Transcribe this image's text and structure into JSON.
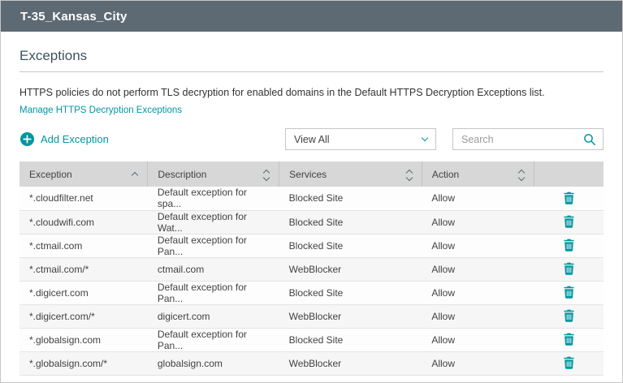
{
  "titlebar": {
    "title": "T-35_Kansas_City"
  },
  "section": {
    "title": "Exceptions"
  },
  "intro": {
    "description": "HTTPS policies do not perform TLS decryption for enabled domains in the Default HTTPS Decryption Exceptions list.",
    "manage_link": "Manage HTTPS Decryption Exceptions"
  },
  "toolbar": {
    "add_label": "Add Exception",
    "filter_value": "View All",
    "search_placeholder": "Search"
  },
  "colors": {
    "accent_teal": "#0097a0",
    "titlebar_bg": "#5d6a74",
    "table_header_bg": "#d7d7d7"
  },
  "table": {
    "columns": [
      "Exception",
      "Description",
      "Services",
      "Action"
    ],
    "sorted_column": "Exception",
    "sort_direction": "asc",
    "rows": [
      {
        "exception": "*.cloudfilter.net",
        "description": "Default exception for spa...",
        "services": "Blocked Site",
        "action": "Allow"
      },
      {
        "exception": "*.cloudwifi.com",
        "description": "Default exception for Wat...",
        "services": "Blocked Site",
        "action": "Allow"
      },
      {
        "exception": "*.ctmail.com",
        "description": "Default exception for Pan...",
        "services": "Blocked Site",
        "action": "Allow"
      },
      {
        "exception": "*.ctmail.com/*",
        "description": "ctmail.com",
        "services": "WebBlocker",
        "action": "Allow"
      },
      {
        "exception": "*.digicert.com",
        "description": "Default exception for Pan...",
        "services": "Blocked Site",
        "action": "Allow"
      },
      {
        "exception": "*.digicert.com/*",
        "description": "digicert.com",
        "services": "WebBlocker",
        "action": "Allow"
      },
      {
        "exception": "*.globalsign.com",
        "description": "Default exception for Pan...",
        "services": "Blocked Site",
        "action": "Allow"
      },
      {
        "exception": "*.globalsign.com/*",
        "description": "globalsign.com",
        "services": "WebBlocker",
        "action": "Allow"
      }
    ]
  }
}
